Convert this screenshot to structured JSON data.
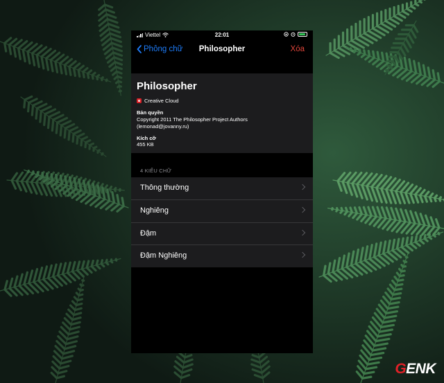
{
  "status_bar": {
    "carrier": "Viettel",
    "time": "22:01",
    "battery_color": "#34c759"
  },
  "nav": {
    "back_label": "Phông chữ",
    "title": "Philosopher",
    "delete_label": "Xóa",
    "back_color": "#1e7dfb",
    "delete_color": "#e0453a"
  },
  "font_info": {
    "name": "Philosopher",
    "provider": "Creative Cloud",
    "copyright_label": "Bản quyền",
    "copyright_line1": "Copyright 2011 The Philosopher Project Authors",
    "copyright_line2": "(lemonad@jovanny.ru)",
    "size_label": "Kích cỡ",
    "size_value": "455 KB"
  },
  "styles_section": {
    "header": "4 KIỂU CHỮ",
    "items": [
      {
        "label": "Thông thường"
      },
      {
        "label": "Nghiêng"
      },
      {
        "label": "Đậm"
      },
      {
        "label": "Đậm Nghiêng"
      }
    ]
  },
  "watermark": {
    "text_accent": "G",
    "text_rest": "ENK"
  }
}
